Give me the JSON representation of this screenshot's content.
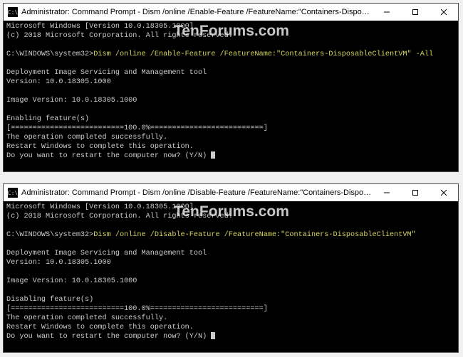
{
  "watermark": "TenForums.com",
  "windows": [
    {
      "title": "Administrator: Command Prompt - Dism  /online /Enable-Feature /FeatureName:\"Containers-DisposableClientVM\" -All",
      "icon_glyph": "C:\\",
      "lines": {
        "l0": "Microsoft Windows [Version 10.0.18305.1000]",
        "l1": "(c) 2018 Microsoft Corporation. All rights reserved.",
        "prompt": "C:\\WINDOWS\\system32>",
        "command": "Dism /online /Enable-Feature /FeatureName:\"Containers-DisposableClientVM\" -All",
        "l3": "Deployment Image Servicing and Management tool",
        "l4": "Version: 10.0.18305.1000",
        "l5": "Image Version: 10.0.18305.1000",
        "l6": "Enabling feature(s)",
        "l7": "[==========================100.0%==========================]",
        "l8": "The operation completed successfully.",
        "l9": "Restart Windows to complete this operation.",
        "l10": "Do you want to restart the computer now? (Y/N) "
      }
    },
    {
      "title": "Administrator: Command Prompt - Dism  /online /Disable-Feature /FeatureName:\"Containers-DisposableClientVM\"",
      "icon_glyph": "C:\\",
      "lines": {
        "l0": "Microsoft Windows [Version 10.0.18305.1000]",
        "l1": "(c) 2018 Microsoft Corporation. All rights reserved.",
        "prompt": "C:\\WINDOWS\\system32>",
        "command": "Dism /online /Disable-Feature /FeatureName:\"Containers-DisposableClientVM\"",
        "l3": "Deployment Image Servicing and Management tool",
        "l4": "Version: 10.0.18305.1000",
        "l5": "Image Version: 10.0.18305.1000",
        "l6": "Disabling feature(s)",
        "l7": "[==========================100.0%==========================]",
        "l8": "The operation completed successfully.",
        "l9": "Restart Windows to complete this operation.",
        "l10": "Do you want to restart the computer now? (Y/N) "
      }
    }
  ]
}
